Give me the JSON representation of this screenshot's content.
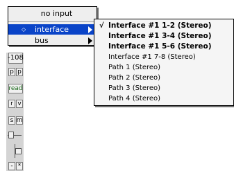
{
  "primary_menu": {
    "items": [
      {
        "label": "no input"
      },
      {
        "label": "interface",
        "bullet": "◇",
        "selected": true,
        "has_submenu": true
      },
      {
        "label": "bus",
        "has_submenu": true
      }
    ]
  },
  "submenu": {
    "items": [
      {
        "label": "Interface #1 1-2 (Stereo)",
        "checked": true,
        "check": "√"
      },
      {
        "label": "Interface #1 3-4 (Stereo)"
      },
      {
        "label": "Interface #1 5-6 (Stereo)"
      },
      {
        "label": "Interface #1 7-8 (Stereo)"
      },
      {
        "label": "Path 1 (Stereo)"
      },
      {
        "label": "Path 2 (Stereo)"
      },
      {
        "label": "Path 3 (Stereo)"
      },
      {
        "label": "Path 4 (Stereo)"
      }
    ]
  },
  "channel_strip": {
    "level": "-108",
    "pan_left": "p",
    "pan_right": "p",
    "automation": "read",
    "record": "r",
    "voice": "v",
    "solo": "s",
    "mute": "m",
    "bottom_left": "-",
    "bottom_right": "*"
  }
}
